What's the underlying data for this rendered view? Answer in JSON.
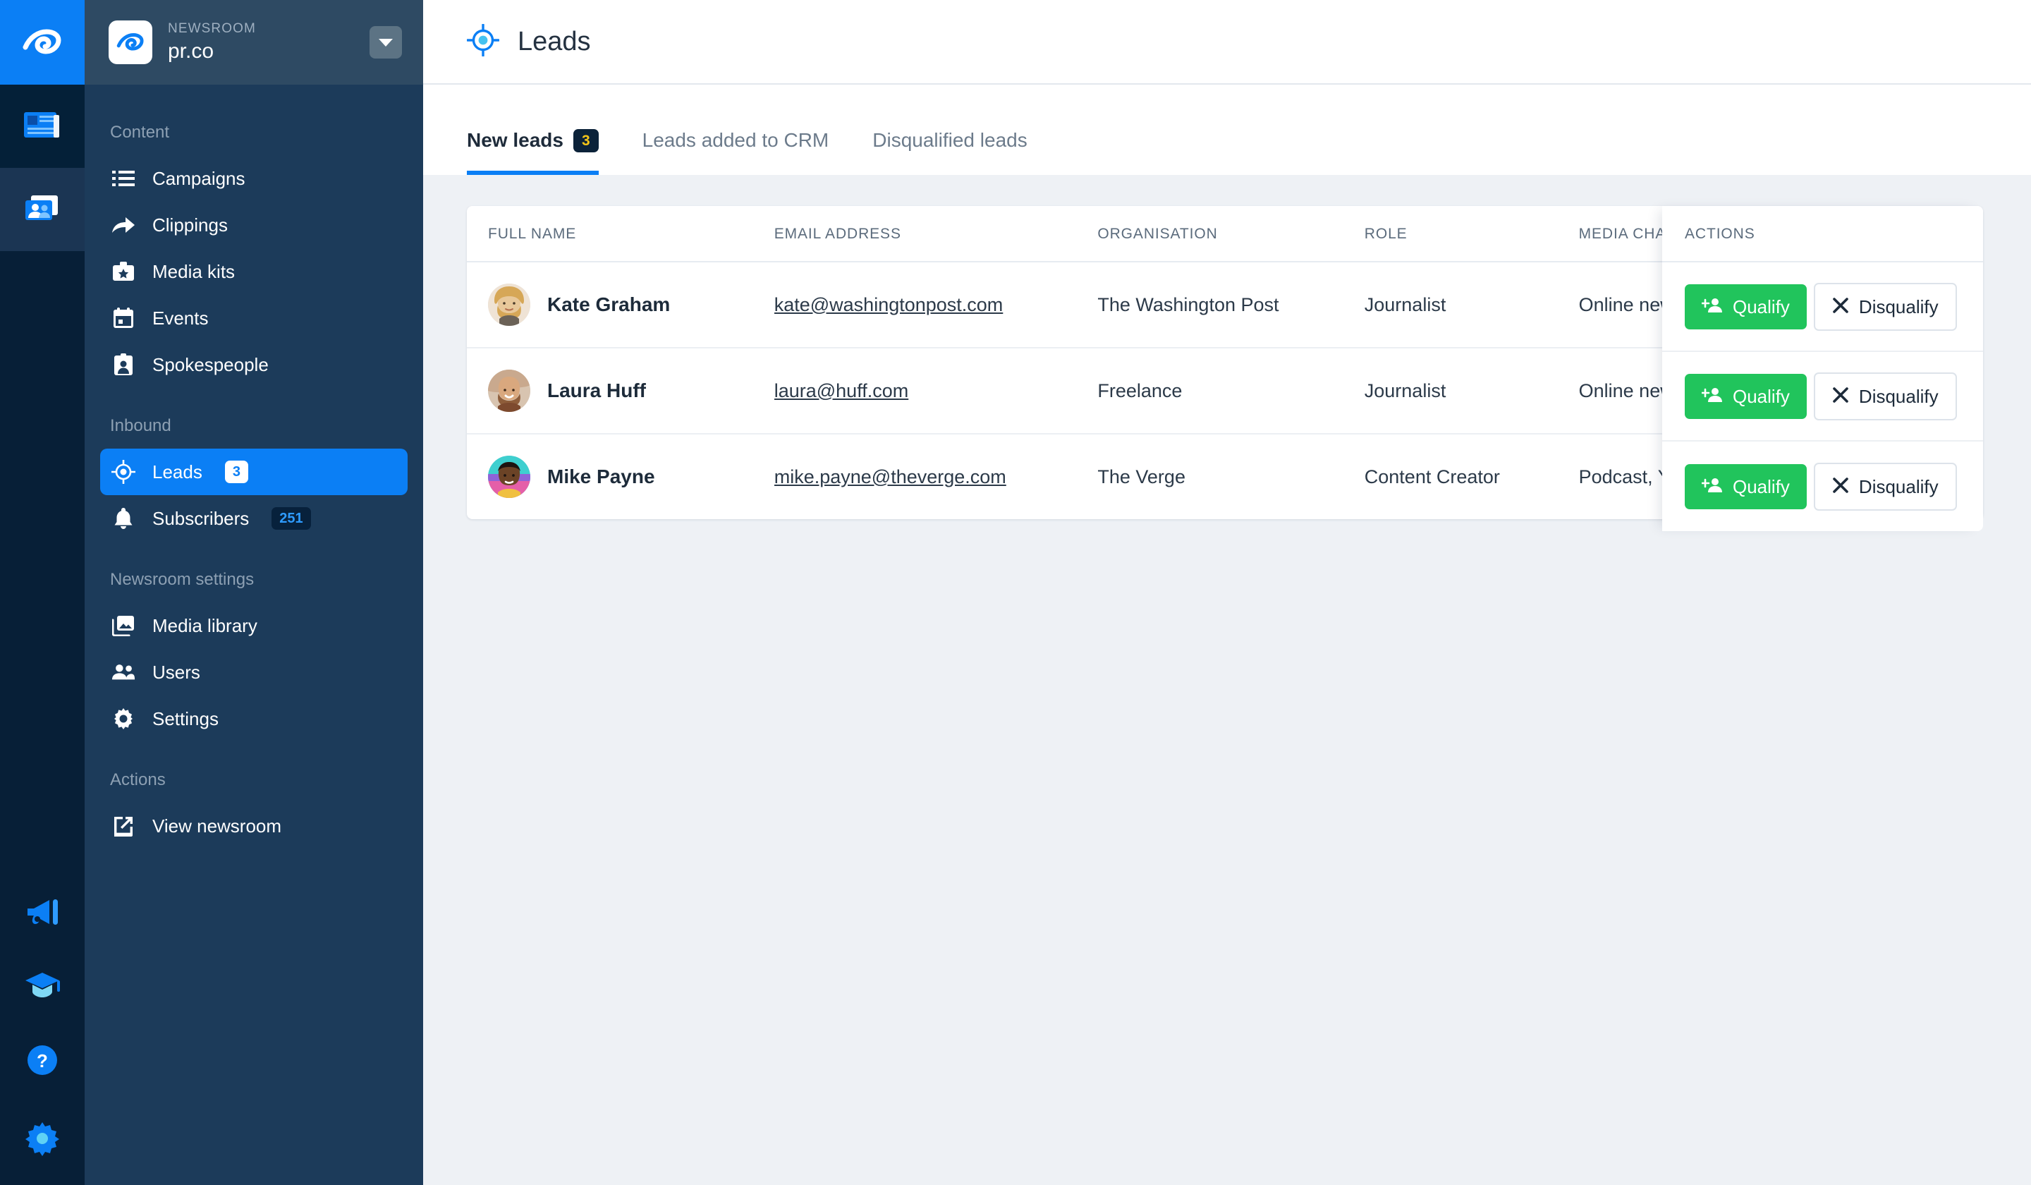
{
  "rail": {
    "logo_icon": "prco-logo-icon",
    "items": [
      {
        "icon": "newspaper-icon",
        "state": "active"
      },
      {
        "icon": "contacts-card-icon",
        "state": "dim"
      }
    ],
    "bottom_items": [
      {
        "icon": "megaphone-icon"
      },
      {
        "icon": "graduation-cap-icon"
      },
      {
        "icon": "help-circle-icon"
      },
      {
        "icon": "gear-icon"
      }
    ]
  },
  "newsroom": {
    "label": "NEWSROOM",
    "name": "pr.co",
    "logo_icon": "prco-mark-icon",
    "caret_icon": "chevron-down-icon"
  },
  "sidebar": {
    "sections": [
      {
        "title": "Content",
        "items": [
          {
            "label": "Campaigns",
            "icon": "list-icon",
            "active": false,
            "badge": null
          },
          {
            "label": "Clippings",
            "icon": "share-arrow-icon",
            "active": false,
            "badge": null
          },
          {
            "label": "Media kits",
            "icon": "briefcase-star-icon",
            "active": false,
            "badge": null
          },
          {
            "label": "Events",
            "icon": "calendar-icon",
            "active": false,
            "badge": null
          },
          {
            "label": "Spokespeople",
            "icon": "id-badge-icon",
            "active": false,
            "badge": null
          }
        ]
      },
      {
        "title": "Inbound",
        "items": [
          {
            "label": "Leads",
            "icon": "target-icon",
            "active": true,
            "badge": "3",
            "badge_style": "white"
          },
          {
            "label": "Subscribers",
            "icon": "bell-icon",
            "active": false,
            "badge": "251",
            "badge_style": "dark"
          }
        ]
      },
      {
        "title": "Newsroom settings",
        "items": [
          {
            "label": "Media library",
            "icon": "image-icon",
            "active": false,
            "badge": null
          },
          {
            "label": "Users",
            "icon": "people-icon",
            "active": false,
            "badge": null
          },
          {
            "label": "Settings",
            "icon": "gear-icon",
            "active": false,
            "badge": null
          }
        ]
      },
      {
        "title": "Actions",
        "items": [
          {
            "label": "View newsroom",
            "icon": "external-link-icon",
            "active": false,
            "badge": null
          }
        ]
      }
    ]
  },
  "header": {
    "title": "Leads",
    "icon": "target-icon"
  },
  "tabs": [
    {
      "label": "New leads",
      "badge": "3",
      "active": true
    },
    {
      "label": "Leads added to CRM",
      "badge": null,
      "active": false
    },
    {
      "label": "Disqualified leads",
      "badge": null,
      "active": false
    }
  ],
  "table": {
    "columns": [
      "FULL NAME",
      "EMAIL ADDRESS",
      "ORGANISATION",
      "ROLE",
      "MEDIA CHANNELS"
    ],
    "actions_column": "ACTIONS",
    "rows": [
      {
        "name": "Kate Graham",
        "email": "kate@washingtonpost.com",
        "organisation": "The Washington Post",
        "role": "Journalist",
        "media_channels": "Online news publication",
        "avatar": "avatar-kate"
      },
      {
        "name": "Laura Huff",
        "email": "laura@huff.com",
        "organisation": "Freelance",
        "role": "Journalist",
        "media_channels": "Online news publication",
        "avatar": "avatar-laura"
      },
      {
        "name": "Mike Payne",
        "email": "mike.payne@theverge.com",
        "organisation": "The Verge",
        "role": "Content Creator",
        "media_channels": "Podcast, YouTube",
        "avatar": "avatar-mike"
      }
    ],
    "qualify_label": "Qualify",
    "disqualify_label": "Disqualify",
    "qualify_icon": "person-add-icon",
    "disqualify_icon": "close-x-icon"
  },
  "colors": {
    "brand_blue": "#0b7ff5",
    "sidebar_bg": "#1c3b5a",
    "rail_bg": "#071f37",
    "qualify_green": "#21c45c",
    "tab_badge_bg": "#0b2239",
    "tab_badge_text": "#f5c518",
    "canvas": "#eef1f5"
  }
}
